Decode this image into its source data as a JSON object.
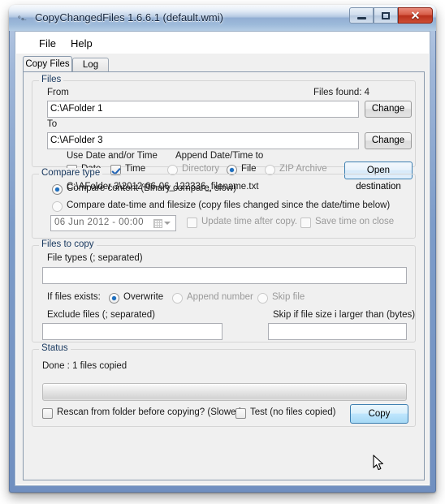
{
  "window": {
    "title": "CopyChangedFiles 1.6.6.1 (default.wmi)",
    "icon": "app-icon",
    "minimize_label": "",
    "maximize_label": "",
    "close_label": "x"
  },
  "menu": {
    "items": [
      {
        "label": "File"
      },
      {
        "label": "Help"
      }
    ]
  },
  "tabs": [
    {
      "label": "Copy Files",
      "selected": true
    },
    {
      "label": "Log",
      "selected": false
    }
  ],
  "files_group": {
    "title": "Files",
    "from_label": "From",
    "from_value": "C:\\AFolder 1",
    "files_found_label": "Files found: 4",
    "from_change_label": "Change",
    "to_label": "To",
    "to_value": "C:\\AFolder 3",
    "to_change_label": "Change",
    "use_date_time_label": "Use Date and/or Time",
    "date_checkbox_label": "Date",
    "time_checkbox_label": "Time",
    "append_label": "Append Date/Time to",
    "append_options": [
      {
        "label": "Directory",
        "selected": false
      },
      {
        "label": "File",
        "selected": true
      },
      {
        "label": "ZIP Archive",
        "selected": false
      }
    ],
    "open_destination_label": "Open destination",
    "preview_path": "C:\\AFolder 3\\2012-06-06_122336_filename.txt"
  },
  "compare_group": {
    "title": "Compare type",
    "options": [
      {
        "label": "Compare content (Binary compare, slow)",
        "selected": true
      },
      {
        "label": "Compare date-time and filesize (copy files changed since the date/time below)",
        "selected": false
      }
    ],
    "date_value": "06   Jun   2012   -   00:00",
    "update_time_label": "Update time after copy.",
    "update_time_checked": false,
    "save_time_label": "Save time on close",
    "save_time_checked": false
  },
  "files_to_copy_group": {
    "title": "Files to copy",
    "file_types_label": "File types (; separated)",
    "file_types_value": "",
    "if_exists_label": "If files exists:",
    "if_exists_options": [
      {
        "label": "Overwrite",
        "selected": true
      },
      {
        "label": "Append number",
        "selected": false
      },
      {
        "label": "Skip file",
        "selected": false
      }
    ],
    "exclude_label": "Exclude files (; separated)",
    "exclude_value": "",
    "skip_size_label": "Skip if file size i larger than (bytes)",
    "skip_size_value": ""
  },
  "status_group": {
    "title": "Status",
    "status_text": "Done : 1 files copied",
    "progress_percent": 0,
    "rescan_label": "Rescan from folder before copying? (Slower)",
    "rescan_checked": false,
    "test_label": "Test (no files copied)",
    "test_checked": false,
    "copy_button_label": "Copy"
  },
  "colors": {
    "accent": "#3c7fb1",
    "group_title": "#17375e",
    "close_button": "#b8301c",
    "client_bg": "#f0f0f0"
  }
}
